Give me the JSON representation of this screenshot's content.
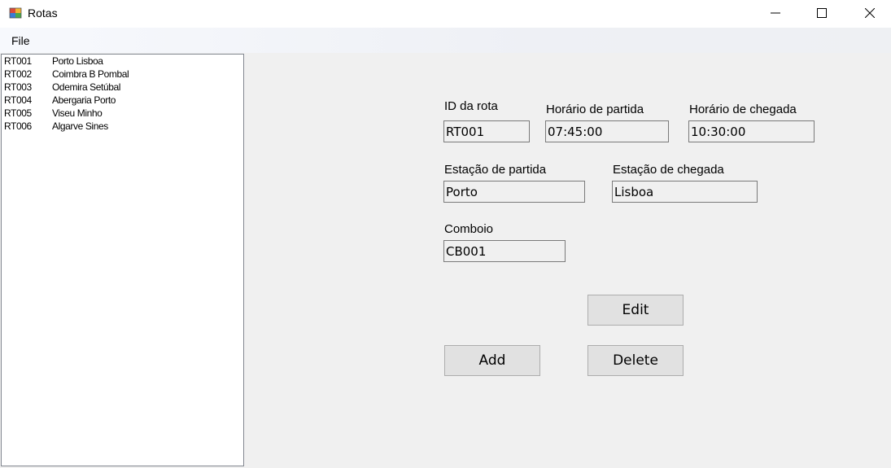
{
  "window": {
    "title": "Rotas"
  },
  "menu": {
    "file": "File"
  },
  "routes": [
    {
      "id": "RT001",
      "name": "Porto Lisboa"
    },
    {
      "id": "RT002",
      "name": "Coimbra B Pombal"
    },
    {
      "id": "RT003",
      "name": "Odemira Setúbal"
    },
    {
      "id": "RT004",
      "name": "Abergaria Porto"
    },
    {
      "id": "RT005",
      "name": "Viseu Minho"
    },
    {
      "id": "RT006",
      "name": "Algarve Sines"
    }
  ],
  "form": {
    "id_label": "ID da rota",
    "id_value": "RT001",
    "departure_time_label": "Horário de partida",
    "departure_time_value": "07:45:00",
    "arrival_time_label": "Horário de chegada",
    "arrival_time_value": "10:30:00",
    "departure_station_label": "Estação de partida",
    "departure_station_value": "Porto",
    "arrival_station_label": "Estação de chegada",
    "arrival_station_value": "Lisboa",
    "train_label": "Comboio",
    "train_value": "CB001"
  },
  "buttons": {
    "edit": "Edit",
    "add": "Add",
    "delete": "Delete"
  },
  "icons": {
    "app": "app-window-icon",
    "minimize": "minimize-icon",
    "maximize": "maximize-icon",
    "close": "close-icon"
  }
}
